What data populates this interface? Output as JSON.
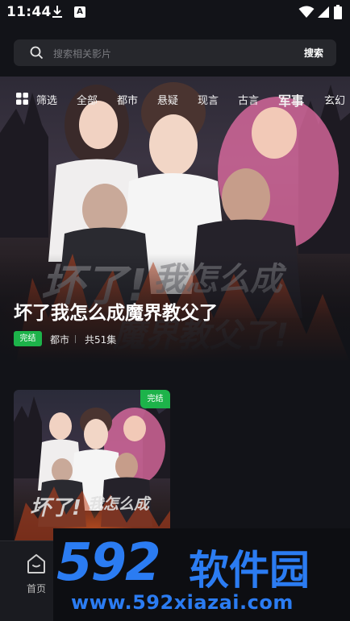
{
  "status_bar": {
    "time": "11:44",
    "app_letter": "A"
  },
  "search": {
    "placeholder": "搜索相关影片",
    "button_label": "搜索"
  },
  "categories": {
    "filter_label": "筛选",
    "items": [
      "全部",
      "都市",
      "悬疑",
      "现言",
      "古言",
      "军事",
      "玄幻"
    ],
    "active": "军事"
  },
  "banner": {
    "title": "坏了我怎么成魔界教父了",
    "status_badge": "完结",
    "genre": "都市",
    "episodes": "共51集"
  },
  "card": {
    "status_badge": "完结"
  },
  "bottom_nav": {
    "home_label": "首页"
  },
  "watermark": {
    "logo_digits": "592",
    "logo_text": "软件园",
    "url": "www.592xiazai.com"
  },
  "colors": {
    "accent_green": "#1db34a",
    "watermark_blue": "#2b7cf2",
    "background": "#121318"
  }
}
